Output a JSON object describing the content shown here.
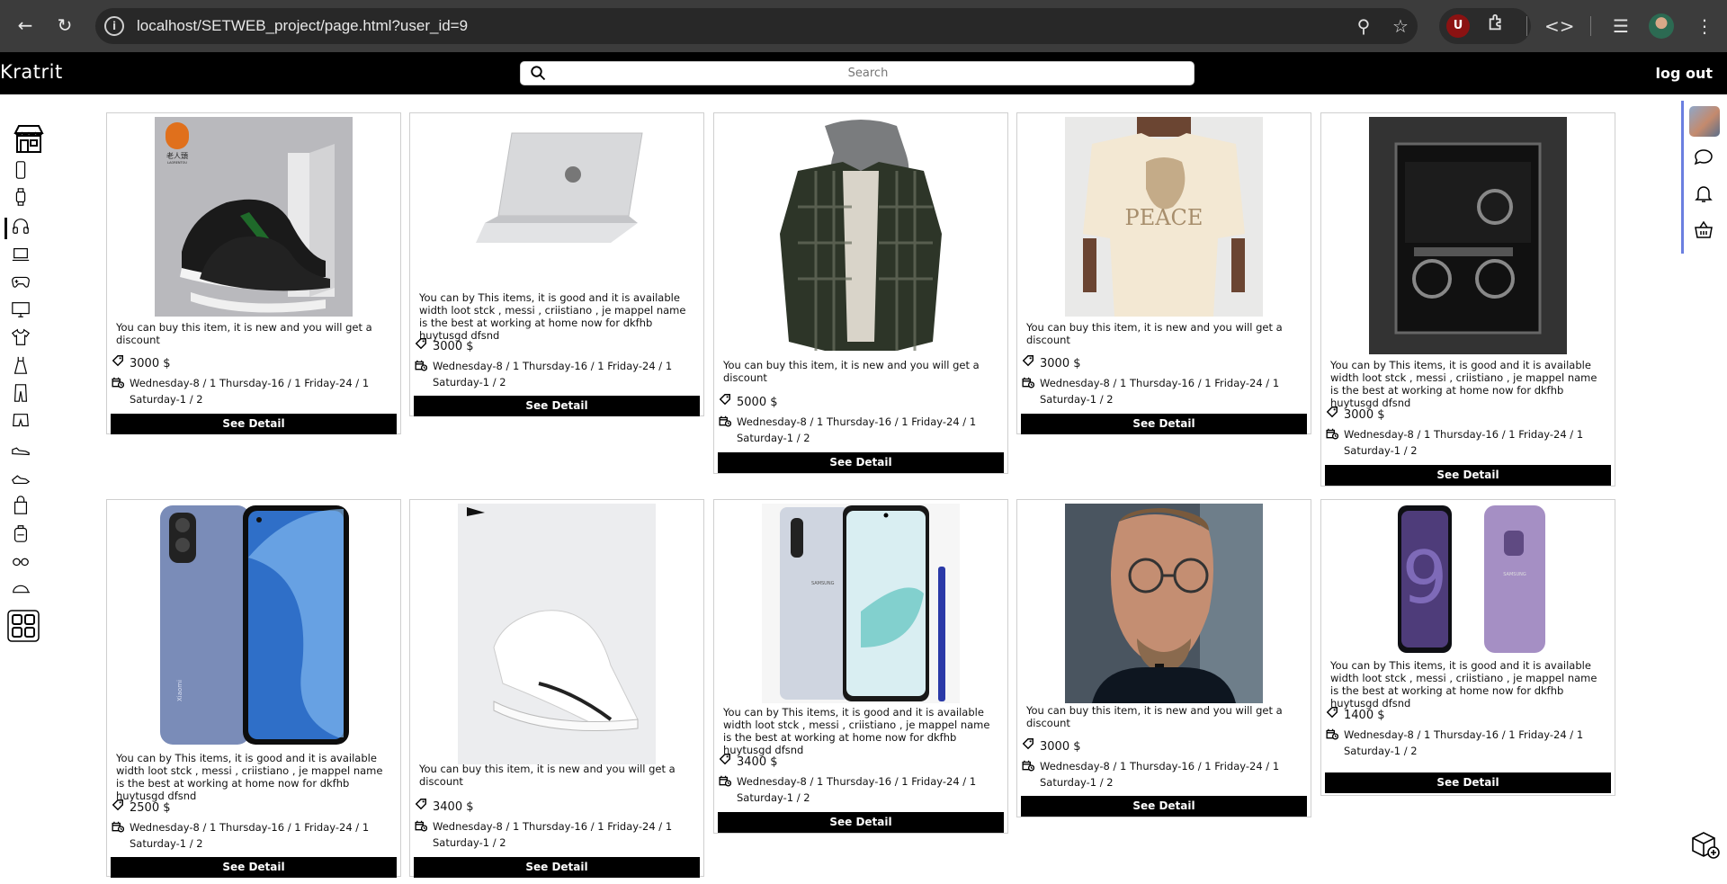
{
  "browser": {
    "url": "localhost/SETWEB_project/page.html?user_id=9",
    "extension_label": "U"
  },
  "header": {
    "logo": "Kratrit",
    "search_placeholder": "Search",
    "logout_label": "log out"
  },
  "left_sidebar": {
    "categories": [
      "store-icon",
      "phone-icon",
      "watch-icon",
      "headphones-icon",
      "laptop-icon",
      "gamepad-icon",
      "monitor-icon",
      "tshirt-icon",
      "dress-icon",
      "pants-icon",
      "shorts-icon",
      "sneaker-icon",
      "shoes-icon",
      "bag-icon",
      "backpack-icon",
      "glasses-icon",
      "cap-icon",
      "grid-icon"
    ]
  },
  "right_sidebar": {
    "icons": [
      "profile-avatar",
      "chat-icon",
      "bell-icon",
      "basket-icon",
      "box-add-icon"
    ]
  },
  "products": [
    {
      "desc": "You can buy this item, it is new and you will get a discount",
      "price": "3000 $",
      "schedule": "Wednesday-8 / 1 Thursday-16 / 1 Friday-24 / 1 Saturday-1 / 2",
      "button": "See Detail"
    },
    {
      "desc": "You can by This items, it is good and it is available width loot stck , messi , criistiano , je mappel name is the best at working at home now for dkfhb huytusgd dfsnd",
      "price": "3000 $",
      "schedule": "Wednesday-8 / 1 Thursday-16 / 1 Friday-24 / 1 Saturday-1 / 2",
      "button": "See Detail"
    },
    {
      "desc": "You can buy this item, it is new and you will get a discount",
      "price": "5000 $",
      "schedule": "Wednesday-8 / 1 Thursday-16 / 1 Friday-24 / 1 Saturday-1 / 2",
      "button": "See Detail"
    },
    {
      "desc": "You can buy this item, it is new and you will get a discount",
      "price": "3000 $",
      "schedule": "Wednesday-8 / 1 Thursday-16 / 1 Friday-24 / 1 Saturday-1 / 2",
      "button": "See Detail"
    },
    {
      "desc": "You can by This items, it is good and it is available width loot stck , messi , criistiano , je mappel name is the best at working at home now for dkfhb huytusgd dfsnd",
      "price": "3000 $",
      "schedule": "Wednesday-8 / 1 Thursday-16 / 1 Friday-24 / 1 Saturday-1 / 2",
      "button": "See Detail"
    },
    {
      "desc": "You can by This items, it is good and it is available width loot stck , messi , criistiano , je mappel name is the best at working at home now for dkfhb huytusgd dfsnd",
      "price": "2500 $",
      "schedule": "Wednesday-8 / 1 Thursday-16 / 1 Friday-24 / 1 Saturday-1 / 2",
      "button": "See Detail"
    },
    {
      "desc": "You can buy this item, it is new and you will get a discount",
      "price": "3400 $",
      "schedule": "Wednesday-8 / 1 Thursday-16 / 1 Friday-24 / 1 Saturday-1 / 2",
      "button": "See Detail"
    },
    {
      "desc": "You can by This items, it is good and it is available width loot stck , messi , criistiano , je mappel name is the best at working at home now for dkfhb huytusgd dfsnd",
      "price": "3400 $",
      "schedule": "Wednesday-8 / 1 Thursday-16 / 1 Friday-24 / 1 Saturday-1 / 2",
      "button": "See Detail"
    },
    {
      "desc": "You can buy this item, it is new and you will get a discount",
      "price": "3000 $",
      "schedule": "Wednesday-8 / 1 Thursday-16 / 1 Friday-24 / 1 Saturday-1 / 2",
      "button": "See Detail"
    },
    {
      "desc": "You can by This items, it is good and it is available width loot stck , messi , criistiano , je mappel name is the best at working at home now for dkfhb huytusgd dfsnd",
      "price": "1400 $",
      "schedule": "Wednesday-8 / 1 Thursday-16 / 1 Friday-24 / 1 Saturday-1 / 2",
      "button": "See Detail"
    }
  ],
  "brand_marks": {
    "shoe_brand_cn": "老人頭",
    "shoe_brand_en": "LAORENTOU",
    "tshirt_print": "PEACE",
    "phone_brand": "SAMSUNG",
    "xiaomi_brand": "Xiaomi"
  }
}
